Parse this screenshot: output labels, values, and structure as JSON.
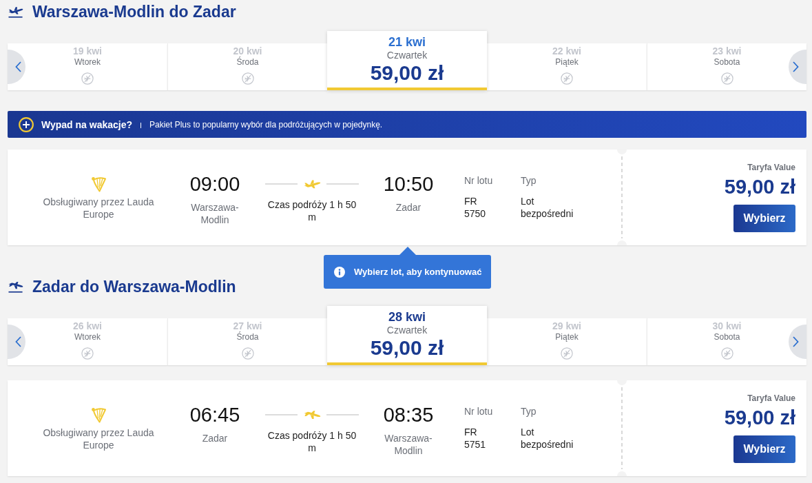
{
  "sections": [
    {
      "kind": "outbound",
      "title": "Warszawa-Modlin do Zadar",
      "dates": [
        {
          "date": "19 kwi",
          "day": "Wtorek",
          "selected": false,
          "hovered": false
        },
        {
          "date": "20 kwi",
          "day": "Środa",
          "selected": false,
          "hovered": false
        },
        {
          "date": "21 kwi",
          "day": "Czwartek",
          "price": "59,00 zł",
          "selected": true,
          "hovered": true
        },
        {
          "date": "22 kwi",
          "day": "Piątek",
          "selected": false,
          "hovered": false
        },
        {
          "date": "23 kwi",
          "day": "Sobota",
          "selected": false,
          "hovered": false
        }
      ],
      "promo": {
        "title": "Wypad na wakacje?",
        "text": "Pakiet Plus to popularny wybór dla podróżujących w pojedynkę."
      },
      "flight": {
        "operator": "Obsługiwany przez Lauda Europe",
        "departure_time": "09:00",
        "departure_city": "Warszawa-Modlin",
        "duration": "Czas podróży 1 h 50 m",
        "arrival_time": "10:50",
        "arrival_city": "Zadar",
        "flight_number_label": "Nr lotu",
        "flight_number": "FR 5750",
        "type_label": "Typ",
        "type": "Lot bezpośredni",
        "fare_label": "Taryfa Value",
        "price": "59,00 zł",
        "button": "Wybierz"
      },
      "tooltip": "Wybierz lot, aby kontynuować"
    },
    {
      "kind": "inbound",
      "title": "Zadar do Warszawa-Modlin",
      "dates": [
        {
          "date": "26 kwi",
          "day": "Wtorek",
          "selected": false,
          "hovered": false
        },
        {
          "date": "27 kwi",
          "day": "Środa",
          "selected": false,
          "hovered": false
        },
        {
          "date": "28 kwi",
          "day": "Czwartek",
          "price": "59,00 zł",
          "selected": true,
          "hovered": false
        },
        {
          "date": "29 kwi",
          "day": "Piątek",
          "selected": false,
          "hovered": false
        },
        {
          "date": "30 kwi",
          "day": "Sobota",
          "selected": false,
          "hovered": false
        }
      ],
      "flight": {
        "operator": "Obsługiwany przez Lauda Europe",
        "departure_time": "06:45",
        "departure_city": "Zadar",
        "duration": "Czas podróży 1 h 50 m",
        "arrival_time": "08:35",
        "arrival_city": "Warszawa-Modlin",
        "flight_number_label": "Nr lotu",
        "flight_number": "FR 5751",
        "type_label": "Typ",
        "type": "Lot bezpośredni",
        "fare_label": "Taryfa Value",
        "price": "59,00 zł",
        "button": "Wybierz"
      }
    }
  ]
}
